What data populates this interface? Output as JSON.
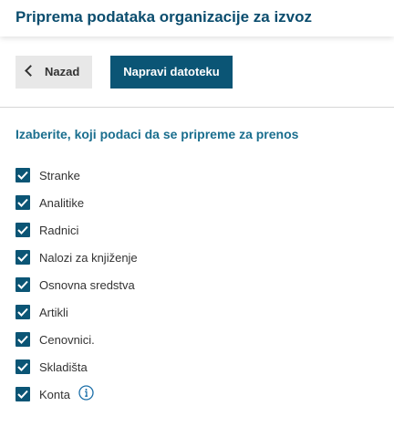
{
  "header": {
    "title": "Priprema podataka organizacije za izvoz"
  },
  "toolbar": {
    "back_label": "Nazad",
    "create_label": "Napravi datoteku"
  },
  "section": {
    "title": "Izaberite, koji podaci da se pripreme za prenos"
  },
  "options": [
    {
      "label": "Stranke",
      "checked": true
    },
    {
      "label": "Analitike",
      "checked": true
    },
    {
      "label": "Radnici",
      "checked": true
    },
    {
      "label": "Nalozi za knjiženje",
      "checked": true
    },
    {
      "label": "Osnovna sredstva",
      "checked": true
    },
    {
      "label": "Artikli",
      "checked": true
    },
    {
      "label": "Cenovnici.",
      "checked": true
    },
    {
      "label": "Skladišta",
      "checked": true
    },
    {
      "label": "Konta",
      "checked": true
    }
  ],
  "icons": {
    "back": "chevron-left-icon",
    "check": "check-icon",
    "info": "info-icon"
  },
  "colors": {
    "primary": "#0b5575",
    "title": "#0b4d6e",
    "section_title": "#1a6e8e",
    "back_button_bg": "#e8e8e8"
  }
}
